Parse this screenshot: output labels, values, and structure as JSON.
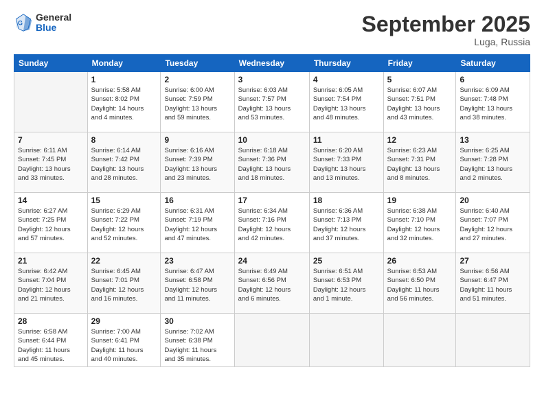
{
  "header": {
    "logo_general": "General",
    "logo_blue": "Blue",
    "month": "September 2025",
    "location": "Luga, Russia"
  },
  "columns": [
    "Sunday",
    "Monday",
    "Tuesday",
    "Wednesday",
    "Thursday",
    "Friday",
    "Saturday"
  ],
  "weeks": [
    [
      {
        "day": "",
        "info": ""
      },
      {
        "day": "1",
        "info": "Sunrise: 5:58 AM\nSunset: 8:02 PM\nDaylight: 14 hours\nand 4 minutes."
      },
      {
        "day": "2",
        "info": "Sunrise: 6:00 AM\nSunset: 7:59 PM\nDaylight: 13 hours\nand 59 minutes."
      },
      {
        "day": "3",
        "info": "Sunrise: 6:03 AM\nSunset: 7:57 PM\nDaylight: 13 hours\nand 53 minutes."
      },
      {
        "day": "4",
        "info": "Sunrise: 6:05 AM\nSunset: 7:54 PM\nDaylight: 13 hours\nand 48 minutes."
      },
      {
        "day": "5",
        "info": "Sunrise: 6:07 AM\nSunset: 7:51 PM\nDaylight: 13 hours\nand 43 minutes."
      },
      {
        "day": "6",
        "info": "Sunrise: 6:09 AM\nSunset: 7:48 PM\nDaylight: 13 hours\nand 38 minutes."
      }
    ],
    [
      {
        "day": "7",
        "info": "Sunrise: 6:11 AM\nSunset: 7:45 PM\nDaylight: 13 hours\nand 33 minutes."
      },
      {
        "day": "8",
        "info": "Sunrise: 6:14 AM\nSunset: 7:42 PM\nDaylight: 13 hours\nand 28 minutes."
      },
      {
        "day": "9",
        "info": "Sunrise: 6:16 AM\nSunset: 7:39 PM\nDaylight: 13 hours\nand 23 minutes."
      },
      {
        "day": "10",
        "info": "Sunrise: 6:18 AM\nSunset: 7:36 PM\nDaylight: 13 hours\nand 18 minutes."
      },
      {
        "day": "11",
        "info": "Sunrise: 6:20 AM\nSunset: 7:33 PM\nDaylight: 13 hours\nand 13 minutes."
      },
      {
        "day": "12",
        "info": "Sunrise: 6:23 AM\nSunset: 7:31 PM\nDaylight: 13 hours\nand 8 minutes."
      },
      {
        "day": "13",
        "info": "Sunrise: 6:25 AM\nSunset: 7:28 PM\nDaylight: 13 hours\nand 2 minutes."
      }
    ],
    [
      {
        "day": "14",
        "info": "Sunrise: 6:27 AM\nSunset: 7:25 PM\nDaylight: 12 hours\nand 57 minutes."
      },
      {
        "day": "15",
        "info": "Sunrise: 6:29 AM\nSunset: 7:22 PM\nDaylight: 12 hours\nand 52 minutes."
      },
      {
        "day": "16",
        "info": "Sunrise: 6:31 AM\nSunset: 7:19 PM\nDaylight: 12 hours\nand 47 minutes."
      },
      {
        "day": "17",
        "info": "Sunrise: 6:34 AM\nSunset: 7:16 PM\nDaylight: 12 hours\nand 42 minutes."
      },
      {
        "day": "18",
        "info": "Sunrise: 6:36 AM\nSunset: 7:13 PM\nDaylight: 12 hours\nand 37 minutes."
      },
      {
        "day": "19",
        "info": "Sunrise: 6:38 AM\nSunset: 7:10 PM\nDaylight: 12 hours\nand 32 minutes."
      },
      {
        "day": "20",
        "info": "Sunrise: 6:40 AM\nSunset: 7:07 PM\nDaylight: 12 hours\nand 27 minutes."
      }
    ],
    [
      {
        "day": "21",
        "info": "Sunrise: 6:42 AM\nSunset: 7:04 PM\nDaylight: 12 hours\nand 21 minutes."
      },
      {
        "day": "22",
        "info": "Sunrise: 6:45 AM\nSunset: 7:01 PM\nDaylight: 12 hours\nand 16 minutes."
      },
      {
        "day": "23",
        "info": "Sunrise: 6:47 AM\nSunset: 6:58 PM\nDaylight: 12 hours\nand 11 minutes."
      },
      {
        "day": "24",
        "info": "Sunrise: 6:49 AM\nSunset: 6:56 PM\nDaylight: 12 hours\nand 6 minutes."
      },
      {
        "day": "25",
        "info": "Sunrise: 6:51 AM\nSunset: 6:53 PM\nDaylight: 12 hours\nand 1 minute."
      },
      {
        "day": "26",
        "info": "Sunrise: 6:53 AM\nSunset: 6:50 PM\nDaylight: 11 hours\nand 56 minutes."
      },
      {
        "day": "27",
        "info": "Sunrise: 6:56 AM\nSunset: 6:47 PM\nDaylight: 11 hours\nand 51 minutes."
      }
    ],
    [
      {
        "day": "28",
        "info": "Sunrise: 6:58 AM\nSunset: 6:44 PM\nDaylight: 11 hours\nand 45 minutes."
      },
      {
        "day": "29",
        "info": "Sunrise: 7:00 AM\nSunset: 6:41 PM\nDaylight: 11 hours\nand 40 minutes."
      },
      {
        "day": "30",
        "info": "Sunrise: 7:02 AM\nSunset: 6:38 PM\nDaylight: 11 hours\nand 35 minutes."
      },
      {
        "day": "",
        "info": ""
      },
      {
        "day": "",
        "info": ""
      },
      {
        "day": "",
        "info": ""
      },
      {
        "day": "",
        "info": ""
      }
    ]
  ]
}
